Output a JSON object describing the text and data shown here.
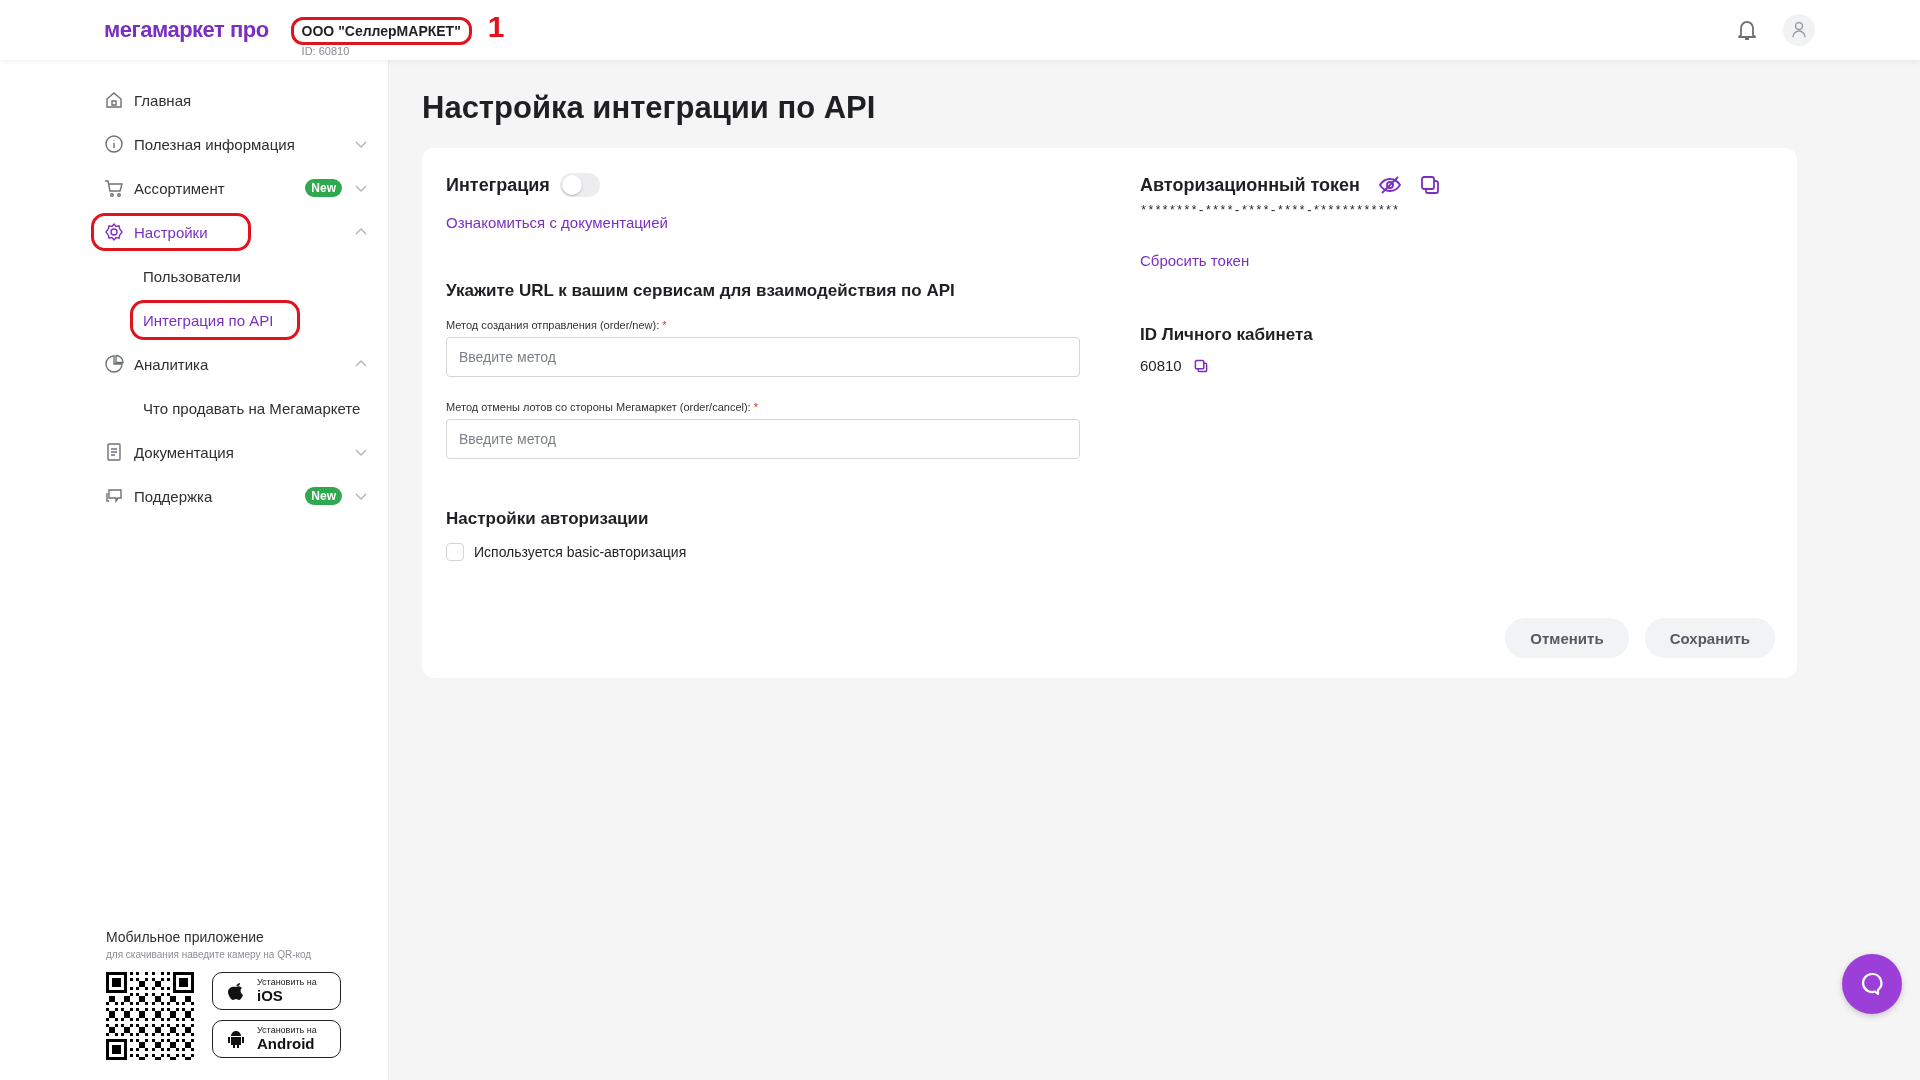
{
  "header": {
    "logo": "мегамаркет про",
    "company": {
      "name": "ООО \"СеллерМАРКЕТ\"",
      "id_label": "ID: 60810",
      "circled": true
    },
    "annotation": "1"
  },
  "sidebar": {
    "items": [
      {
        "kind": "link",
        "label": "Главная",
        "selected": false,
        "circled": false
      },
      {
        "kind": "group",
        "label": "Полезная информация",
        "selected": false,
        "circled": false,
        "expanded": false
      },
      {
        "kind": "group",
        "label": "Ассортимент",
        "badge": "New",
        "selected": false,
        "circled": false,
        "expanded": false
      },
      {
        "kind": "group",
        "label": "Настройки",
        "selected": true,
        "circled": true,
        "expanded": true,
        "children": [
          {
            "label": "Пользователи",
            "selected": false,
            "circled": false
          },
          {
            "label": "Интеграция по API",
            "selected": true,
            "circled": true
          }
        ]
      },
      {
        "kind": "group",
        "label": "Аналитика",
        "selected": false,
        "circled": false,
        "expanded": true,
        "children": [
          {
            "label": "Что продавать на Мегамаркете",
            "selected": false,
            "circled": false
          }
        ]
      },
      {
        "kind": "group",
        "label": "Документация",
        "selected": false,
        "circled": false,
        "expanded": false
      },
      {
        "kind": "group",
        "label": "Поддержка",
        "badge": "New",
        "selected": false,
        "circled": false,
        "expanded": false
      }
    ],
    "mobile": {
      "heading": "Мобильное приложение",
      "hint": "для скачивания наведите камеру на QR-код",
      "stores": [
        {
          "small": "Установить на",
          "big": "iOS"
        },
        {
          "small": "Установить на",
          "big": "Android"
        }
      ]
    }
  },
  "main": {
    "title": "Настройка интеграции по API",
    "integration": {
      "label": "Интеграция",
      "on": false
    },
    "doc_link": "Ознакомиться с документацией",
    "url_section": {
      "heading": "Укажите URL к вашим сервисам для взаимодействия по API",
      "fields": [
        {
          "label": "Метод создания отправления (order/new):",
          "required": "*",
          "placeholder": "Введите метод"
        },
        {
          "label": "Метод отмены лотов со стороны Мегамаркет (order/cancel):",
          "required": "*",
          "placeholder": "Введите метод"
        }
      ]
    },
    "auth": {
      "heading": "Настройки авторизации",
      "checkbox": {
        "label": "Используется basic-авторизация",
        "checked": false
      }
    },
    "token": {
      "heading": "Авторизационный токен",
      "value": "********-****-****-****-************",
      "reset_link": "Сбросить токен"
    },
    "account": {
      "heading": "ID Личного кабинета",
      "value": "60810"
    },
    "buttons": [
      "Отменить",
      "Сохранить"
    ]
  }
}
